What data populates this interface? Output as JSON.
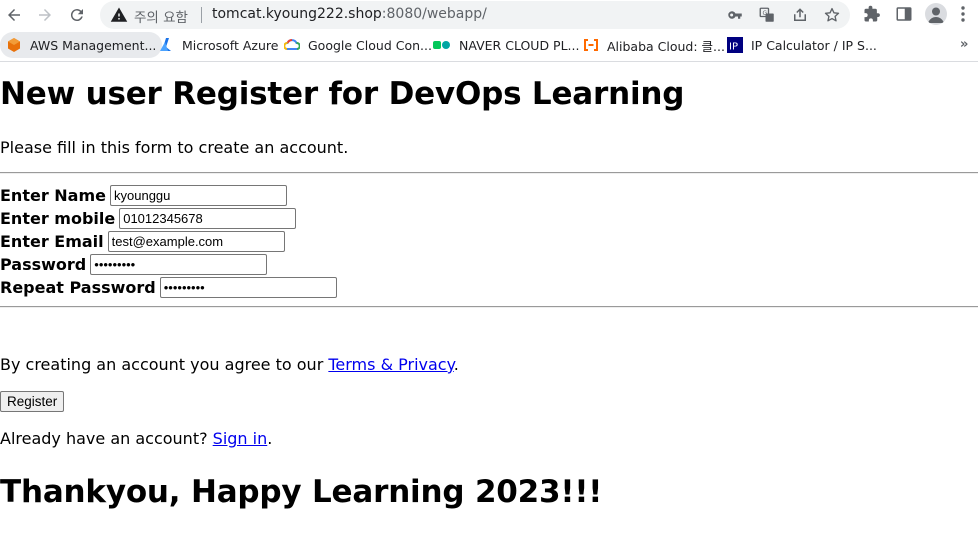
{
  "browser": {
    "security_status": "주의 요함",
    "url_host": "tomcat.kyoung222.shop",
    "url_rest": ":8080/webapp/",
    "bookmarks": [
      {
        "label": "AWS Management...",
        "icon": "aws-icon"
      },
      {
        "label": "Microsoft Azure",
        "icon": "azure-icon"
      },
      {
        "label": "Google Cloud Con...",
        "icon": "google-cloud-icon"
      },
      {
        "label": "NAVER CLOUD PL...",
        "icon": "naver-cloud-icon"
      },
      {
        "label": "Alibaba Cloud: 클...",
        "icon": "alibaba-cloud-icon"
      },
      {
        "label": "IP Calculator / IP S...",
        "icon": "ip-calculator-icon"
      }
    ],
    "more_bookmarks": "»"
  },
  "page": {
    "title": "New user Register for DevOps Learning",
    "intro": "Please fill in this form to create an account.",
    "form": {
      "name_label": "Enter Name",
      "name_value": "kyounggu",
      "mobile_label": "Enter mobile",
      "mobile_value": "01012345678",
      "email_label": "Enter Email",
      "email_value": "test@example.com",
      "password_label": "Password",
      "password_value": "•••••••••",
      "repeat_label": "Repeat Password",
      "repeat_value": "•••••••••"
    },
    "agree_prefix": "By creating an account you agree to our ",
    "terms_link": "Terms & Privacy",
    "agree_suffix": ".",
    "register_button": "Register",
    "signin_prefix": "Already have an account? ",
    "signin_link": "Sign in",
    "signin_suffix": ".",
    "footer_title": "Thankyou, Happy Learning 2023!!!"
  }
}
